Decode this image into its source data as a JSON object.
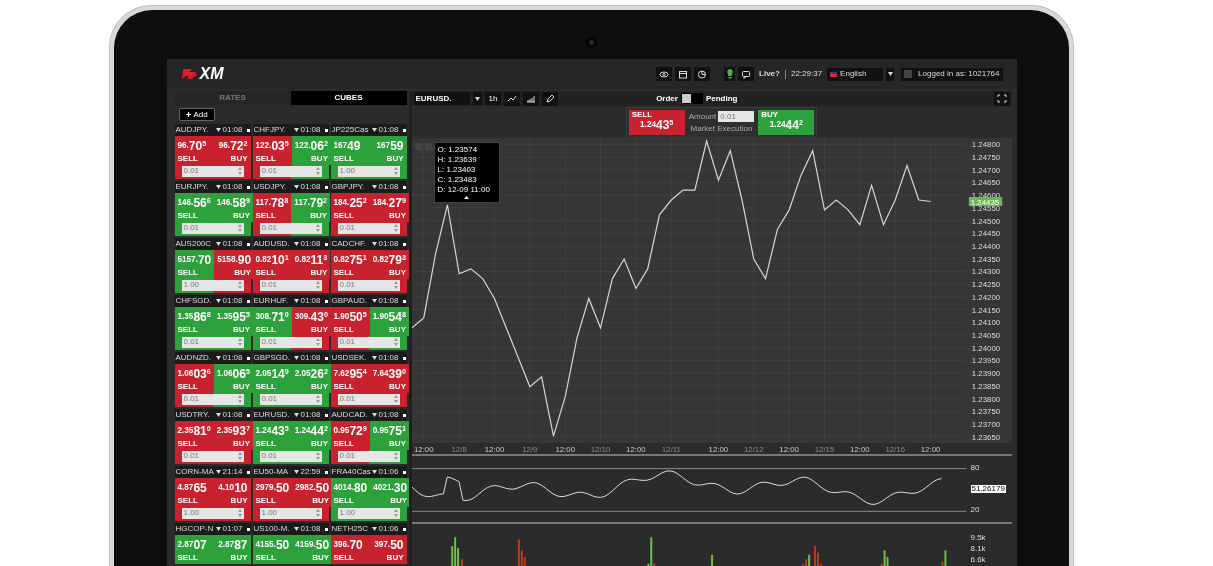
{
  "top_bar": {
    "logo": "XM",
    "status": "Live?",
    "clock": "22:29:37",
    "language": "English",
    "login": "Logged in as: 1021764"
  },
  "panel_tabs": [
    {
      "label": "RATES",
      "selected": false
    },
    {
      "label": "CUBES",
      "selected": true
    }
  ],
  "add_button": "Add",
  "cubes": [
    {
      "symbol": "AUDJPY.",
      "time": "01:08",
      "sell": {
        "label": "SELL",
        "rising": false,
        "price": {
          "small": "96.",
          "big": "70",
          "sup": "5"
        }
      },
      "buy": {
        "label": "BUY",
        "rising": false,
        "price": {
          "small": "96.",
          "big": "72",
          "sup": "2"
        }
      },
      "amount": "0.01"
    },
    {
      "symbol": "CHFJPY.",
      "time": "01:08",
      "sell": {
        "label": "SELL",
        "rising": false,
        "price": {
          "small": "122.",
          "big": "03",
          "sup": "5"
        }
      },
      "buy": {
        "label": "BUY",
        "rising": true,
        "price": {
          "small": "122.",
          "big": "06",
          "sup": "2"
        }
      },
      "amount": "0.01"
    },
    {
      "symbol": "JP225Cas",
      "time": "01:08",
      "sell": {
        "label": "SELL",
        "rising": true,
        "price": {
          "small": "167",
          "big": "49"
        }
      },
      "buy": {
        "label": "BUY",
        "rising": true,
        "price": {
          "small": "167",
          "big": "59"
        }
      },
      "amount": "1.00"
    },
    {
      "symbol": "EURJPY.",
      "time": "01:08",
      "sell": {
        "label": "SELL",
        "rising": true,
        "price": {
          "small": "146.",
          "big": "56",
          "sup": "6"
        }
      },
      "buy": {
        "label": "BUY",
        "rising": true,
        "price": {
          "small": "146.",
          "big": "58",
          "sup": "9"
        }
      },
      "amount": "0.01"
    },
    {
      "symbol": "USDJPY.",
      "time": "01:08",
      "sell": {
        "label": "SELL",
        "rising": false,
        "price": {
          "small": "117.",
          "big": "78",
          "sup": "8"
        }
      },
      "buy": {
        "label": "BUY",
        "rising": true,
        "price": {
          "small": "117.",
          "big": "79",
          "sup": "2"
        }
      },
      "amount": "0.01"
    },
    {
      "symbol": "GBPJPY.",
      "time": "01:08",
      "sell": {
        "label": "SELL",
        "rising": false,
        "price": {
          "small": "184.",
          "big": "25",
          "sup": "2"
        }
      },
      "buy": {
        "label": "BUY",
        "rising": false,
        "price": {
          "small": "184.",
          "big": "27",
          "sup": "9"
        }
      },
      "amount": "0.01"
    },
    {
      "symbol": "AUS200C",
      "time": "01:08",
      "sell": {
        "label": "SELL",
        "rising": true,
        "price": {
          "small": "5157.",
          "big": "70"
        }
      },
      "buy": {
        "label": "BUY",
        "rising": false,
        "price": {
          "small": "5158.",
          "big": "90"
        }
      },
      "amount": "1.00"
    },
    {
      "symbol": "AUDUSD.",
      "time": "01:08",
      "sell": {
        "label": "SELL",
        "rising": false,
        "price": {
          "small": "0.82",
          "big": "10",
          "sup": "1"
        }
      },
      "buy": {
        "label": "BUY",
        "rising": false,
        "price": {
          "small": "0.82",
          "big": "11",
          "sup": "3"
        }
      },
      "amount": "0.01"
    },
    {
      "symbol": "CADCHF.",
      "time": "01:08",
      "sell": {
        "label": "SELL",
        "rising": false,
        "price": {
          "small": "0.82",
          "big": "75",
          "sup": "1"
        }
      },
      "buy": {
        "label": "BUY",
        "rising": false,
        "price": {
          "small": "0.82",
          "big": "79",
          "sup": "3"
        }
      },
      "amount": "0.01"
    },
    {
      "symbol": "CHFSGD.",
      "time": "01:08",
      "sell": {
        "label": "SELL",
        "rising": true,
        "price": {
          "small": "1.35",
          "big": "86",
          "sup": "8"
        }
      },
      "buy": {
        "label": "BUY",
        "rising": true,
        "price": {
          "small": "1.35",
          "big": "95",
          "sup": "5"
        }
      },
      "amount": "0.01"
    },
    {
      "symbol": "EURHUF.",
      "time": "01:08",
      "sell": {
        "label": "SELL",
        "rising": true,
        "price": {
          "small": "308.",
          "big": "71",
          "sup": "0"
        }
      },
      "buy": {
        "label": "BUY",
        "rising": false,
        "price": {
          "small": "309.",
          "big": "43",
          "sup": "0"
        }
      },
      "amount": "0.01"
    },
    {
      "symbol": "GBPAUD.",
      "time": "01:08",
      "sell": {
        "label": "SELL",
        "rising": false,
        "price": {
          "small": "1.90",
          "big": "50",
          "sup": "5"
        }
      },
      "buy": {
        "label": "BUY",
        "rising": true,
        "price": {
          "small": "1.90",
          "big": "54",
          "sup": "8"
        }
      },
      "amount": "0.01"
    },
    {
      "symbol": "AUDNZD.",
      "time": "01:08",
      "sell": {
        "label": "SELL",
        "rising": false,
        "price": {
          "small": "1.06",
          "big": "03",
          "sup": "6"
        }
      },
      "buy": {
        "label": "BUY",
        "rising": true,
        "price": {
          "small": "1.06",
          "big": "06",
          "sup": "5"
        }
      },
      "amount": "0.01"
    },
    {
      "symbol": "GBPSGD.",
      "time": "01:08",
      "sell": {
        "label": "SELL",
        "rising": true,
        "price": {
          "small": "2.05",
          "big": "14",
          "sup": "9"
        }
      },
      "buy": {
        "label": "BUY",
        "rising": true,
        "price": {
          "small": "2.05",
          "big": "26",
          "sup": "2"
        }
      },
      "amount": "0.01"
    },
    {
      "symbol": "USDSEK.",
      "time": "01:08",
      "sell": {
        "label": "SELL",
        "rising": false,
        "price": {
          "small": "7.62",
          "big": "95",
          "sup": "4"
        }
      },
      "buy": {
        "label": "BUY",
        "rising": false,
        "price": {
          "small": "7.64",
          "big": "39",
          "sup": "0"
        }
      },
      "amount": "0.01"
    },
    {
      "symbol": "USDTRY.",
      "time": "01:08",
      "sell": {
        "label": "SELL",
        "rising": false,
        "price": {
          "small": "2.35",
          "big": "81",
          "sup": "0"
        }
      },
      "buy": {
        "label": "BUY",
        "rising": false,
        "price": {
          "small": "2.35",
          "big": "93",
          "sup": "7"
        }
      },
      "amount": "0.01"
    },
    {
      "symbol": "EURUSD.",
      "time": "01:08",
      "sell": {
        "label": "SELL",
        "rising": true,
        "price": {
          "small": "1.24",
          "big": "43",
          "sup": "5"
        }
      },
      "buy": {
        "label": "BUY",
        "rising": true,
        "price": {
          "small": "1.24",
          "big": "44",
          "sup": "2"
        }
      },
      "amount": "0.01"
    },
    {
      "symbol": "AUDCAD.",
      "time": "01:08",
      "sell": {
        "label": "SELL",
        "rising": false,
        "price": {
          "small": "0.95",
          "big": "72",
          "sup": "9"
        }
      },
      "buy": {
        "label": "BUY",
        "rising": true,
        "price": {
          "small": "0.95",
          "big": "75",
          "sup": "1"
        }
      },
      "amount": "0.01"
    },
    {
      "symbol": "CORN-MA",
      "time": "21:14",
      "sell": {
        "label": "SELL",
        "rising": false,
        "price": {
          "small": "4.87",
          "big": "65"
        }
      },
      "buy": {
        "label": "BUY",
        "rising": false,
        "price": {
          "small": "4.10",
          "big": "10"
        }
      },
      "amount": "1.00"
    },
    {
      "symbol": "EU50-MA",
      "time": "22:59",
      "sell": {
        "label": "SELL",
        "rising": false,
        "price": {
          "small": "2979.",
          "big": "50"
        }
      },
      "buy": {
        "label": "BUY",
        "rising": false,
        "price": {
          "small": "2982.",
          "big": "50"
        }
      },
      "amount": "1.00"
    },
    {
      "symbol": "FRA40Cas",
      "time": "01:06",
      "sell": {
        "label": "SELL",
        "rising": true,
        "price": {
          "small": "4014.",
          "big": "80"
        }
      },
      "buy": {
        "label": "BUY",
        "rising": true,
        "price": {
          "small": "4021.",
          "big": "30"
        }
      },
      "amount": "1.00"
    },
    {
      "symbol": "HGCOP-N",
      "time": "01:07",
      "sell": {
        "label": "SELL",
        "rising": true,
        "price": {
          "small": "2.87",
          "big": "07"
        }
      },
      "buy": {
        "label": "BUY",
        "rising": true,
        "price": {
          "small": "2.87",
          "big": "87"
        }
      }
    },
    {
      "symbol": "US100-M.",
      "time": "01:08",
      "sell": {
        "label": "SELL",
        "rising": true,
        "price": {
          "small": "4155.",
          "big": "50"
        }
      },
      "buy": {
        "label": "BUY",
        "rising": true,
        "price": {
          "small": "4159.",
          "big": "50"
        }
      }
    },
    {
      "symbol": "NETH25C",
      "time": "01:06",
      "sell": {
        "label": "SELL",
        "rising": false,
        "price": {
          "small": "396.",
          "big": "70"
        }
      },
      "buy": {
        "label": "BUY",
        "rising": false,
        "price": {
          "small": "397.",
          "big": "50"
        }
      }
    }
  ],
  "chart_toolbar": {
    "symbol": "EURUSD.",
    "timeframe": "1h",
    "order_label": "Order",
    "pending_on": false,
    "pending_label": "Pending"
  },
  "trade": {
    "sell": {
      "label": "SELL",
      "price": {
        "small": "1.24",
        "big": "43",
        "sup": "5"
      }
    },
    "amount_label": "Amount",
    "amount": "0.01",
    "execution": "Market Execution",
    "buy": {
      "label": "BUY",
      "price": {
        "small": "1.24",
        "big": "44",
        "sup": "2"
      }
    }
  },
  "ohlc": [
    "O: 1.23574",
    "H: 1.23639",
    "L: 1.23403",
    "C: 1.23483",
    "D: 12-09 11:00"
  ],
  "price_chart": {
    "price_tag": "1.24435",
    "chart_data": {
      "type": "line",
      "grid": true,
      "ylim": [
        1.23625,
        1.24825
      ],
      "categories": [
        null,
        "12:00",
        null,
        null,
        "12/8",
        null,
        null,
        "12:00",
        null,
        null,
        "12/9",
        null,
        null,
        "12:00",
        null,
        null,
        "12/10",
        null,
        null,
        "12:00",
        null,
        null,
        "12/11",
        null,
        null,
        null,
        "12:00",
        null,
        null,
        "12/12",
        null,
        null,
        "12:00",
        null,
        null,
        "12/15",
        null,
        null,
        "12:00",
        null,
        null,
        "12/16",
        null,
        null,
        "12:00"
      ],
      "series": [
        {
          "color": "#d8d8d8",
          "values": [
            1.24078,
            1.24117,
            1.24368,
            1.24562,
            1.24291,
            1.2431,
            1.24272,
            1.24194,
            1.24078,
            1.23962,
            1.23846,
            1.23885,
            1.23652,
            1.23807,
            1.24039,
            1.24194,
            1.24078,
            1.24272,
            1.24349,
            1.24233,
            1.2431,
            1.24523,
            1.24581,
            1.2462,
            1.2462,
            1.24813,
            1.24659,
            1.24775,
            1.24581,
            1.24349,
            1.24272,
            1.24465,
            1.24542,
            1.24678,
            1.24775,
            1.24542,
            1.24581,
            1.24542,
            1.24484,
            1.24639,
            1.24484,
            1.24581,
            1.24717,
            1.24581,
            1.24575
          ]
        }
      ],
      "yticks": [
        {
          "value": 1.248,
          "label": "1.24800"
        },
        {
          "value": 1.2475,
          "label": "1.24750"
        },
        {
          "value": 1.247,
          "label": "1.24700"
        },
        {
          "value": 1.2465,
          "label": "1.24650"
        },
        {
          "value": 1.246,
          "label": "1.24600"
        },
        {
          "value": 1.2455,
          "label": "1.24550"
        },
        {
          "value": 1.245,
          "label": "1.24500"
        },
        {
          "value": 1.2445,
          "label": "1.24450"
        },
        {
          "value": 1.244,
          "label": "1.24400"
        },
        {
          "value": 1.2435,
          "label": "1.24350"
        },
        {
          "value": 1.243,
          "label": "1.24300"
        },
        {
          "value": 1.2425,
          "label": "1.24250"
        },
        {
          "value": 1.242,
          "label": "1.24200"
        },
        {
          "value": 1.2415,
          "label": "1.24150"
        },
        {
          "value": 1.241,
          "label": "1.24100"
        },
        {
          "value": 1.2405,
          "label": "1.24050"
        },
        {
          "value": 1.24,
          "label": "1.24000"
        },
        {
          "value": 1.2395,
          "label": "1.23950"
        },
        {
          "value": 1.239,
          "label": "1.23900"
        },
        {
          "value": 1.2385,
          "label": "1.23850"
        },
        {
          "value": 1.238,
          "label": "1.23800"
        },
        {
          "value": 1.2375,
          "label": "1.23750"
        },
        {
          "value": 1.237,
          "label": "1.23700"
        },
        {
          "value": 1.2365,
          "label": "1.23650"
        }
      ]
    }
  },
  "rsi": {
    "upper": "80",
    "lower": "20",
    "value": "51.26179"
  },
  "volume": {
    "labels": [
      "9.5k",
      "8.1k",
      "6.6k"
    ]
  }
}
